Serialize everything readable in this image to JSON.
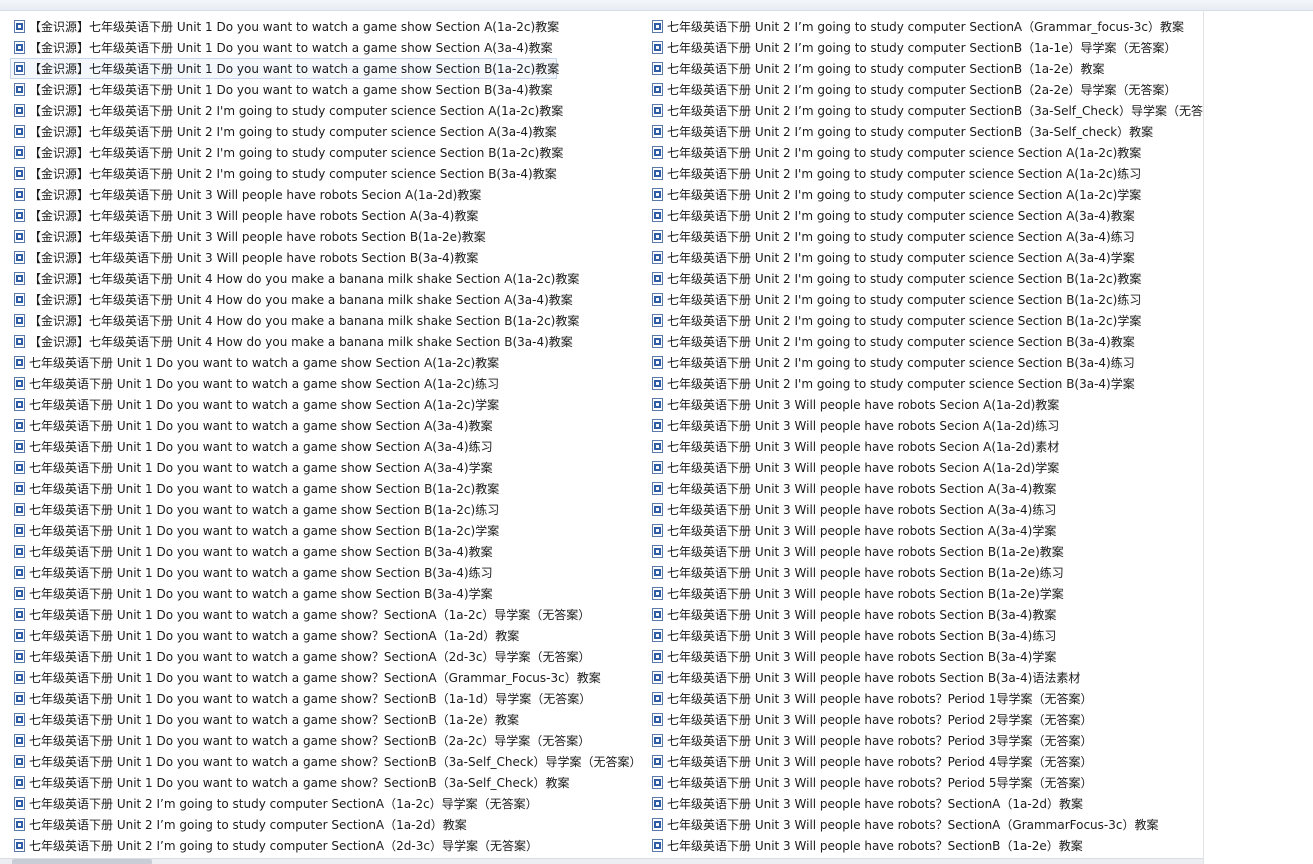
{
  "file_icon": "word-document-icon",
  "selected_index": 2,
  "left_column": [
    "【金识源】七年级英语下册 Unit 1 Do you want to watch a game show Section A(1a-2c)教案",
    "【金识源】七年级英语下册 Unit 1 Do you want to watch a game show Section A(3a-4)教案",
    "【金识源】七年级英语下册 Unit 1 Do you want to watch a game show Section B(1a-2c)教案",
    "【金识源】七年级英语下册 Unit 1 Do you want to watch a game show Section B(3a-4)教案",
    "【金识源】七年级英语下册 Unit 2 I'm going to study computer science Section A(1a-2c)教案",
    "【金识源】七年级英语下册 Unit 2 I'm going to study computer science Section A(3a-4)教案",
    "【金识源】七年级英语下册 Unit 2 I'm going to study computer science Section B(1a-2c)教案",
    "【金识源】七年级英语下册 Unit 2 I'm going to study computer science Section B(3a-4)教案",
    "【金识源】七年级英语下册 Unit 3 Will people have robots Secion A(1a-2d)教案",
    "【金识源】七年级英语下册 Unit 3 Will people have robots Section A(3a-4)教案",
    "【金识源】七年级英语下册 Unit 3 Will people have robots Section B(1a-2e)教案",
    "【金识源】七年级英语下册 Unit 3 Will people have robots Section B(3a-4)教案",
    "【金识源】七年级英语下册 Unit 4 How do you make a banana milk shake Section A(1a-2c)教案",
    "【金识源】七年级英语下册 Unit 4 How do you make a banana milk shake Section A(3a-4)教案",
    "【金识源】七年级英语下册 Unit 4 How do you make a banana milk shake Section B(1a-2c)教案",
    "【金识源】七年级英语下册 Unit 4 How do you make a banana milk shake Section B(3a-4)教案",
    "七年级英语下册 Unit 1 Do you want to watch a game show Section A(1a-2c)教案",
    "七年级英语下册 Unit 1 Do you want to watch a game show Section A(1a-2c)练习",
    "七年级英语下册 Unit 1 Do you want to watch a game show Section A(1a-2c)学案",
    "七年级英语下册 Unit 1 Do you want to watch a game show Section A(3a-4)教案",
    "七年级英语下册 Unit 1 Do you want to watch a game show Section A(3a-4)练习",
    "七年级英语下册 Unit 1 Do you want to watch a game show Section A(3a-4)学案",
    "七年级英语下册 Unit 1 Do you want to watch a game show Section B(1a-2c)教案",
    "七年级英语下册 Unit 1 Do you want to watch a game show Section B(1a-2c)练习",
    "七年级英语下册 Unit 1 Do you want to watch a game show Section B(1a-2c)学案",
    "七年级英语下册 Unit 1 Do you want to watch a game show Section B(3a-4)教案",
    "七年级英语下册 Unit 1 Do you want to watch a game show Section B(3a-4)练习",
    "七年级英语下册 Unit 1 Do you want to watch a game show Section B(3a-4)学案",
    "七年级英语下册 Unit 1 Do you want to watch a game show？SectionA（1a-2c）导学案（无答案）",
    "七年级英语下册 Unit 1 Do you want to watch a game show？SectionA（1a-2d）教案",
    "七年级英语下册 Unit 1 Do you want to watch a game show？SectionA（2d-3c）导学案（无答案）",
    "七年级英语下册 Unit 1 Do you want to watch a game show？SectionA（Grammar_Focus-3c）教案",
    "七年级英语下册 Unit 1 Do you want to watch a game show？SectionB（1a-1d）导学案（无答案）",
    "七年级英语下册 Unit 1 Do you want to watch a game show？SectionB（1a-2e）教案",
    "七年级英语下册 Unit 1 Do you want to watch a game show？SectionB（2a-2c）导学案（无答案）",
    "七年级英语下册 Unit 1 Do you want to watch a game show？SectionB（3a-Self_Check）导学案（无答案）",
    "七年级英语下册 Unit 1 Do you want to watch a game show？SectionB（3a-Self_Check）教案",
    "七年级英语下册 Unit 2 I’m going to study computer SectionA（1a-2c）导学案（无答案）",
    "七年级英语下册 Unit 2 I’m going to study computer SectionA（1a-2d）教案",
    "七年级英语下册 Unit 2 I’m going to study computer SectionA（2d-3c）导学案（无答案）"
  ],
  "right_column": [
    "七年级英语下册 Unit 2 I’m going to study computer SectionA（Grammar_focus-3c）教案",
    "七年级英语下册 Unit 2 I’m going to study computer SectionB（1a-1e）导学案（无答案）",
    "七年级英语下册 Unit 2 I’m going to study computer SectionB（1a-2e）教案",
    "七年级英语下册 Unit 2 I’m going to study computer SectionB（2a-2e）导学案（无答案）",
    "七年级英语下册 Unit 2 I’m going to study computer SectionB（3a-Self_Check）导学案（无答",
    "七年级英语下册 Unit 2 I’m going to study computer SectionB（3a-Self_check）教案",
    "七年级英语下册 Unit 2 I'm going to study computer science Section A(1a-2c)教案",
    "七年级英语下册 Unit 2 I'm going to study computer science Section A(1a-2c)练习",
    "七年级英语下册 Unit 2 I'm going to study computer science Section A(1a-2c)学案",
    "七年级英语下册 Unit 2 I'm going to study computer science Section A(3a-4)教案",
    "七年级英语下册 Unit 2 I'm going to study computer science Section A(3a-4)练习",
    "七年级英语下册 Unit 2 I'm going to study computer science Section A(3a-4)学案",
    "七年级英语下册 Unit 2 I'm going to study computer science Section B(1a-2c)教案",
    "七年级英语下册 Unit 2 I'm going to study computer science Section B(1a-2c)练习",
    "七年级英语下册 Unit 2 I'm going to study computer science Section B(1a-2c)学案",
    "七年级英语下册 Unit 2 I'm going to study computer science Section B(3a-4)教案",
    "七年级英语下册 Unit 2 I'm going to study computer science Section B(3a-4)练习",
    "七年级英语下册 Unit 2 I'm going to study computer science Section B(3a-4)学案",
    "七年级英语下册 Unit 3 Will people have robots Secion A(1a-2d)教案",
    "七年级英语下册 Unit 3 Will people have robots Secion A(1a-2d)练习",
    "七年级英语下册 Unit 3 Will people have robots Secion A(1a-2d)素材",
    "七年级英语下册 Unit 3 Will people have robots Secion A(1a-2d)学案",
    "七年级英语下册 Unit 3 Will people have robots Section A(3a-4)教案",
    "七年级英语下册 Unit 3 Will people have robots Section A(3a-4)练习",
    "七年级英语下册 Unit 3 Will people have robots Section A(3a-4)学案",
    "七年级英语下册 Unit 3 Will people have robots Section B(1a-2e)教案",
    "七年级英语下册 Unit 3 Will people have robots Section B(1a-2e)练习",
    "七年级英语下册 Unit 3 Will people have robots Section B(1a-2e)学案",
    "七年级英语下册 Unit 3 Will people have robots Section B(3a-4)教案",
    "七年级英语下册 Unit 3 Will people have robots Section B(3a-4)练习",
    "七年级英语下册 Unit 3 Will people have robots Section B(3a-4)学案",
    "七年级英语下册 Unit 3 Will people have robots Section B(3a-4)语法素材",
    "七年级英语下册 Unit 3 Will people have robots？Period 1导学案（无答案）",
    "七年级英语下册 Unit 3 Will people have robots？Period 2导学案（无答案）",
    "七年级英语下册 Unit 3 Will people have robots？Period 3导学案（无答案）",
    "七年级英语下册 Unit 3 Will people have robots？Period 4导学案（无答案）",
    "七年级英语下册 Unit 3 Will people have robots？Period 5导学案（无答案）",
    "七年级英语下册 Unit 3 Will people have robots？SectionA（1a-2d）教案",
    "七年级英语下册 Unit 3 Will people have robots？SectionA（GrammarFocus-3c）教案",
    "七年级英语下册 Unit 3 Will people have robots？SectionB（1a-2e）教案"
  ]
}
